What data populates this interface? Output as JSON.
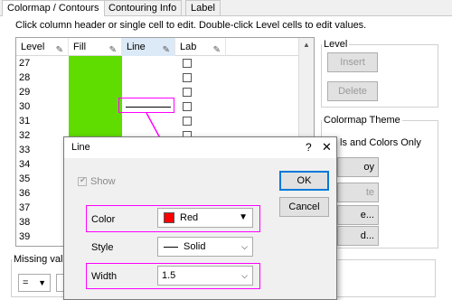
{
  "tabs": [
    {
      "label": "Colormap / Contours"
    },
    {
      "label": "Contouring Info"
    },
    {
      "label": "Label"
    }
  ],
  "instructions": "Click column header or single cell to edit. Double-click Level cells to edit values.",
  "grid": {
    "headers": [
      "Level",
      "Fill",
      "Line",
      "Lab"
    ],
    "levels": [
      "27",
      "28",
      "29",
      "30",
      "31",
      "32",
      "33",
      "34",
      "35",
      "36",
      "37",
      "38",
      "39"
    ]
  },
  "level_group": {
    "legend": "Level",
    "insert": "Insert",
    "delete": "Delete"
  },
  "theme_group": {
    "legend": "Colormap Theme",
    "partial_text": "ls and Colors Only",
    "btn1": "oy",
    "btn2": "te",
    "btn3": "e...",
    "btn4": "d..."
  },
  "missing": {
    "legend": "Missing valu",
    "op": "="
  },
  "dialog": {
    "title": "Line",
    "help": "?",
    "close": "✕",
    "show_label": "Show",
    "ok": "OK",
    "cancel": "Cancel",
    "color_label": "Color",
    "color_value": "Red",
    "color_swatch": "#ff0000",
    "style_label": "Style",
    "style_value": "Solid",
    "width_label": "Width",
    "width_value": "1.5"
  },
  "colors": {
    "highlight": "#ff00ff",
    "fill_green": "#5fdc00"
  }
}
